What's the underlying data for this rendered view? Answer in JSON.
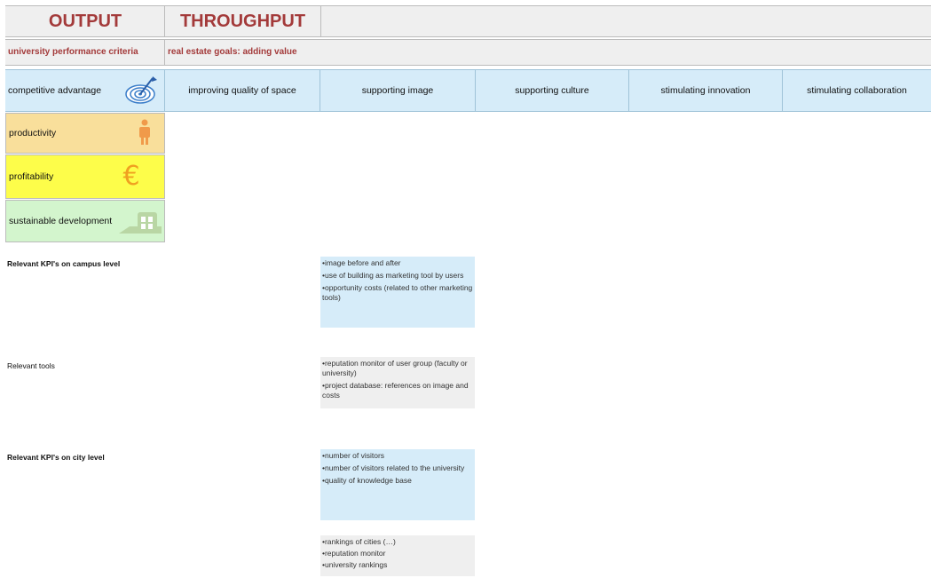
{
  "header": {
    "output": "OUTPUT",
    "throughput": "THROUGHPUT",
    "criteria": "university performance criteria",
    "goals": "real estate goals: adding value"
  },
  "criteria_rows": [
    {
      "label": "competitive advantage",
      "icon": "target-icon"
    },
    {
      "label": "productivity",
      "icon": "person-icon"
    },
    {
      "label": "profitability",
      "icon": "euro-icon"
    },
    {
      "label": "sustainable development",
      "icon": "building-icon"
    }
  ],
  "goals": [
    "improving quality of space",
    "supporting image",
    "supporting culture",
    "stimulating innovation",
    "stimulating collaboration"
  ],
  "sections": {
    "campus_kpi_label": "Relevant KPI's on campus level",
    "tools_label": "Relevant tools",
    "city_kpi_label": "Relevant KPI's on city level"
  },
  "campus_kpis": [
    "•image before and after",
    "•use of building as marketing tool by users",
    "•opportunity costs (related to other marketing tools)"
  ],
  "tools": [
    "•reputation monitor of user group (faculty or university)",
    "•project database: references on image and costs"
  ],
  "city_kpis": [
    "•number of visitors",
    "•number of visitors related to the university",
    "•quality of knowledge base"
  ],
  "city_tools": [
    "•rankings of cities (…)",
    "•reputation monitor",
    "•university rankings"
  ],
  "colors": {
    "accent": "#a33a3a",
    "goal_bg": "#d6ecf9",
    "productivity_bg": "#f9df9b",
    "profitability_bg": "#fdfd4a",
    "sustainable_bg": "#d3f5cd",
    "tools_bg": "#efefef"
  }
}
